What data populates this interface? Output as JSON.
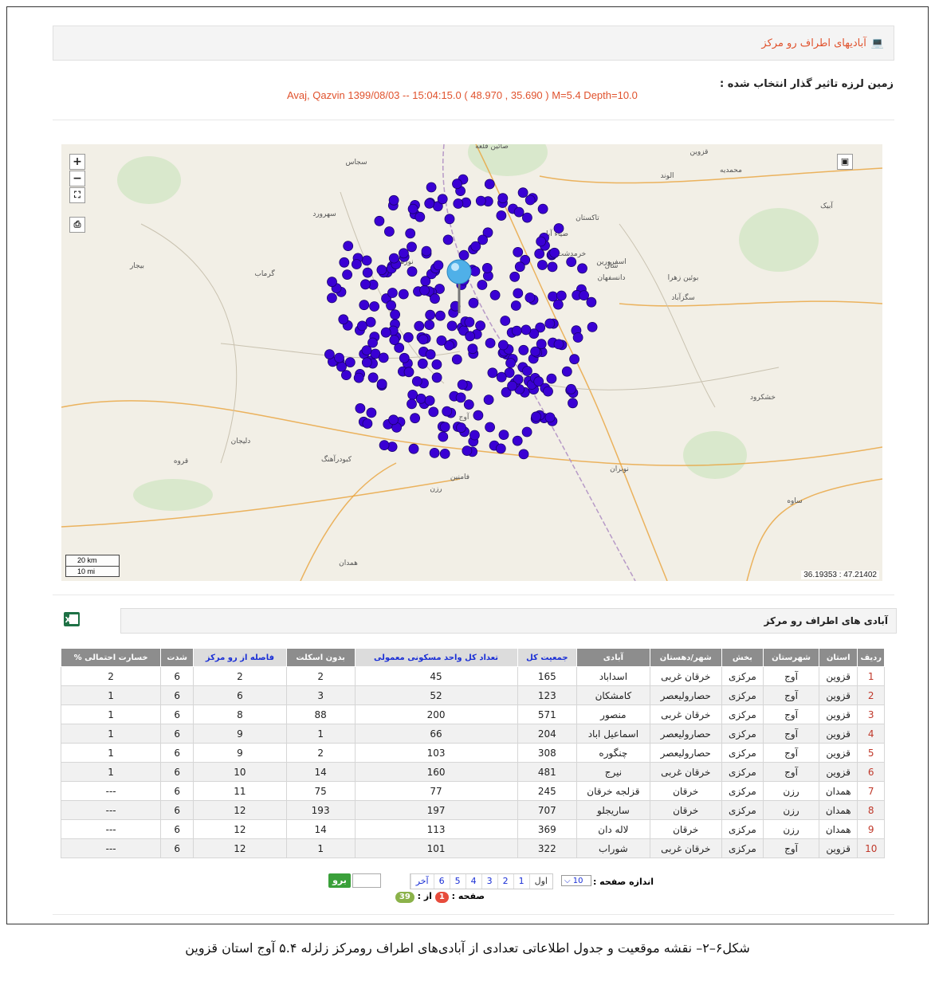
{
  "header": {
    "title": "آبادیهای اطراف رو مرکز",
    "icon": "laptop-icon"
  },
  "quake": {
    "label": "زمین لرزه تاثیر گذار انتخاب شده :",
    "info": "Avaj, Qazvin 1399/08/03 -- 15:04:15.0 ( 48.970 , 35.690 ) M=5.4 Depth=10.0"
  },
  "map": {
    "zoom_in": "+",
    "zoom_out": "−",
    "fullscreen_icon": "fullscreen-icon",
    "print_icon": "print-icon",
    "layers_icon": "layers-icon",
    "scale_km": "20 km",
    "scale_mi": "10 mi",
    "coords": "36.19353 : 47.21402",
    "marker_color": "#3a00d4",
    "labels": [
      {
        "t": "قزوین"
      },
      {
        "t": "تاکستان"
      },
      {
        "t": "آبیک"
      },
      {
        "t": "بوئین زهرا"
      },
      {
        "t": "همدان"
      },
      {
        "t": "کبودرآهنگ"
      },
      {
        "t": "رزن"
      },
      {
        "t": "ساوه"
      },
      {
        "t": "آوج"
      },
      {
        "t": "خرمدشت"
      },
      {
        "t": "دانسفهان"
      },
      {
        "t": "اسفرورین"
      },
      {
        "t": "ضیاء آباد"
      },
      {
        "t": "نورهار"
      },
      {
        "t": "گرماب"
      },
      {
        "t": "بیجار"
      },
      {
        "t": "فامنین"
      },
      {
        "t": "خشکرود"
      },
      {
        "t": "نوبران"
      },
      {
        "t": "سجاس"
      },
      {
        "t": "صائین قلعه"
      },
      {
        "t": "محمدیه"
      },
      {
        "t": "الوند"
      },
      {
        "t": "شال"
      },
      {
        "t": "سگزآباد"
      },
      {
        "t": "قروه"
      },
      {
        "t": "دلیجان"
      },
      {
        "t": "سهرورد"
      }
    ]
  },
  "table_title": "آبادی های اطراف رو مرکز",
  "excel_icon": "excel-icon",
  "columns": [
    "ردیف",
    "استان",
    "شهرستان",
    "بخش",
    "شهر/دهستان",
    "آبادی",
    "جمعیت کل",
    "تعداد کل واحد مسکونی معمولی",
    "بدون اسکلت",
    "فاصله از رو مرکز",
    "شدت",
    "خسارت احتمالی %"
  ],
  "rows": [
    [
      "1",
      "قزوین",
      "آوج",
      "مرکزی",
      "خرقان غربی",
      "اسداباد",
      "165",
      "45",
      "2",
      "2",
      "6",
      "2"
    ],
    [
      "2",
      "قزوین",
      "آوج",
      "مرکزی",
      "حصارولیعصر",
      "کامشکان",
      "123",
      "52",
      "3",
      "6",
      "6",
      "1"
    ],
    [
      "3",
      "قزوین",
      "آوج",
      "مرکزی",
      "خرقان غربی",
      "منصور",
      "571",
      "200",
      "88",
      "8",
      "6",
      "1"
    ],
    [
      "4",
      "قزوین",
      "آوج",
      "مرکزی",
      "حصارولیعصر",
      "اسماعیل اباد",
      "204",
      "66",
      "1",
      "9",
      "6",
      "1"
    ],
    [
      "5",
      "قزوین",
      "آوج",
      "مرکزی",
      "حصارولیعصر",
      "چنگوره",
      "308",
      "103",
      "2",
      "9",
      "6",
      "1"
    ],
    [
      "6",
      "قزوین",
      "آوج",
      "مرکزی",
      "خرقان غربی",
      "نیرج",
      "481",
      "160",
      "14",
      "10",
      "6",
      "1"
    ],
    [
      "7",
      "همدان",
      "رزن",
      "مرکزی",
      "خرقان",
      "قزلجه خرقان",
      "245",
      "77",
      "75",
      "11",
      "6",
      "---"
    ],
    [
      "8",
      "همدان",
      "رزن",
      "مرکزی",
      "خرقان",
      "ساریجلو",
      "707",
      "197",
      "193",
      "12",
      "6",
      "---"
    ],
    [
      "9",
      "همدان",
      "رزن",
      "مرکزی",
      "خرقان",
      "لاله دان",
      "369",
      "113",
      "14",
      "12",
      "6",
      "---"
    ],
    [
      "10",
      "قزوین",
      "آوج",
      "مرکزی",
      "خرقان غربی",
      "شوراب",
      "322",
      "101",
      "1",
      "12",
      "6",
      "---"
    ]
  ],
  "pager": {
    "page_size_label": "اندازه صفحه :",
    "page_size": "10",
    "first": "اول",
    "pages": [
      "1",
      "2",
      "3",
      "4",
      "5",
      "6"
    ],
    "last": "آخر",
    "go": "برو",
    "page_label": "صفحه :",
    "current": "1",
    "of_label": "از :",
    "total": "39"
  },
  "caption": "شکل۶–۲– نقشه موقعیت و جدول اطلاعاتی تعدادی از آبادی‌های اطراف رومرکز زلزله ۵.۴  آوج استان قزوین"
}
